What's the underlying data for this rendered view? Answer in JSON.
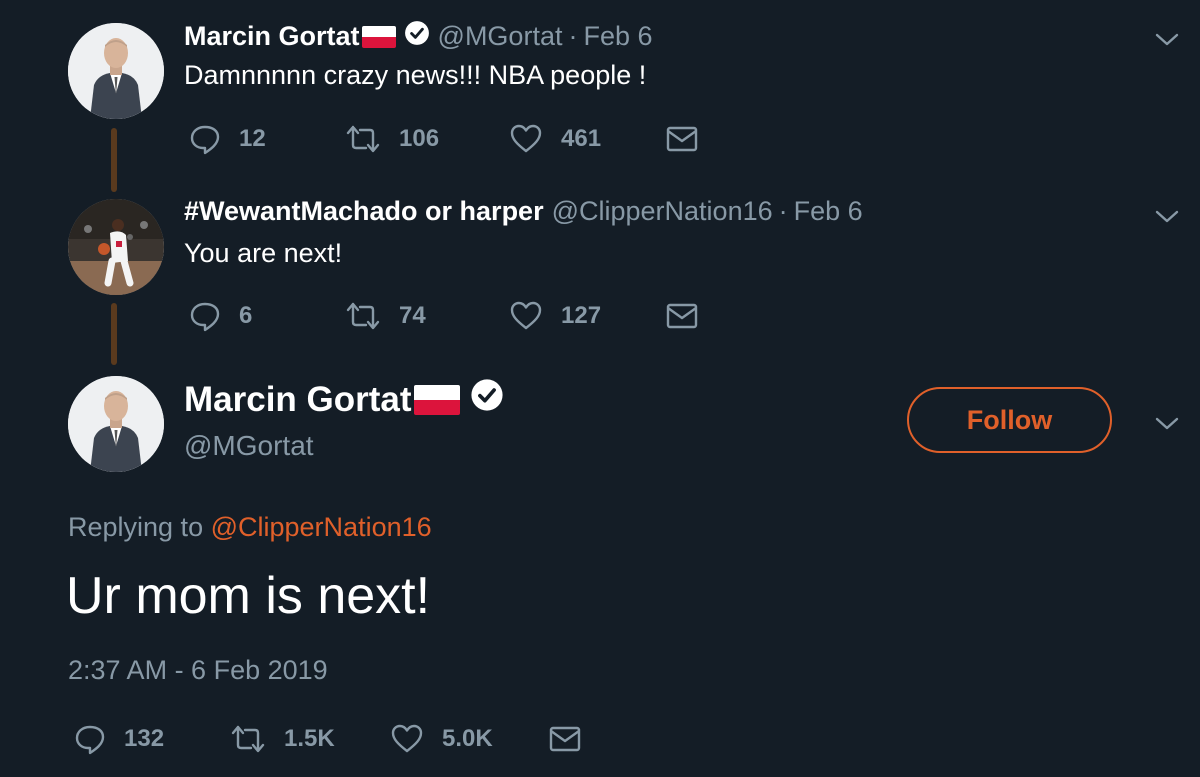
{
  "colors": {
    "background": "#141d26",
    "muted": "#8899a6",
    "accent": "#e0602a",
    "thread_line": "#5a3a1e"
  },
  "tweet1": {
    "name": "Marcin Gortat",
    "flag": "poland-flag",
    "verified": true,
    "handle": "@MGortat",
    "separator": "·",
    "date": "Feb 6",
    "text": "Damnnnnn crazy news!!! NBA people !",
    "replies": "12",
    "retweets": "106",
    "likes": "461"
  },
  "tweet2": {
    "name": "#WewantMachado or harper",
    "handle": "@ClipperNation16",
    "separator": "·",
    "date": "Feb 6",
    "text": "You are next!",
    "replies": "6",
    "retweets": "74",
    "likes": "127"
  },
  "main_tweet": {
    "name": "Marcin Gortat",
    "flag": "poland-flag",
    "verified": true,
    "handle": "@MGortat",
    "follow_label": "Follow",
    "replying_prefix": "Replying to",
    "replying_to": "@ClipperNation16",
    "text": "Ur mom is next!",
    "timestamp": "2:37 AM - 6 Feb 2019",
    "replies": "132",
    "retweets": "1.5K",
    "likes": "5.0K"
  }
}
